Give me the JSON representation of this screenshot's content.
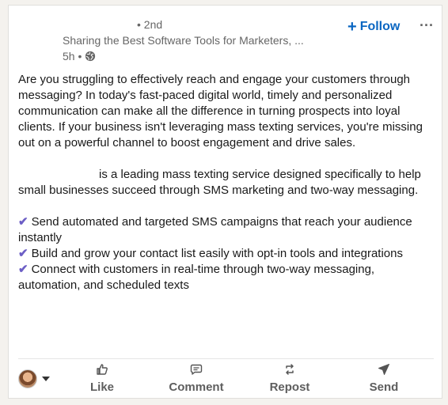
{
  "post": {
    "actor": {
      "degree": "• 2nd",
      "headline": "Sharing the Best Software Tools for Marketers, ...",
      "time": "5h •",
      "visibility_icon": "globe-icon",
      "follow_label": "Follow",
      "more_icon": "ellipsis-icon"
    },
    "body": {
      "p1": "Are you struggling to effectively reach and engage your customers through messaging? In today's fast-paced digital world, timely and personalized communication can make all the difference in turning prospects into loyal clients. If your business isn't leveraging mass texting services, you're missing out on a powerful channel to boost engagement and drive sales.",
      "p2": "is a leading mass texting service designed specifically to help small businesses succeed through SMS marketing and two-way messaging.",
      "bullets": [
        "Send automated and targeted SMS campaigns that reach your audience instantly",
        "Build and grow your contact list easily with opt-in tools and integrations",
        "Connect with customers in real-time through two-way messaging, automation, and scheduled texts"
      ],
      "bullet_glyph": "✔"
    },
    "actions": {
      "like": "Like",
      "comment": "Comment",
      "repost": "Repost",
      "send": "Send"
    }
  },
  "colors": {
    "accent": "#0a66c2",
    "check": "#6c5ec5",
    "text": "#191919",
    "muted": "#666666"
  }
}
